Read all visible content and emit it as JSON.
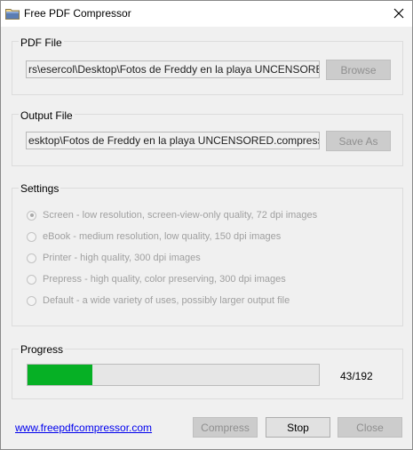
{
  "window": {
    "title": "Free PDF Compressor"
  },
  "pdf_file": {
    "label": "PDF File",
    "path": "rs\\esercol\\Desktop\\Fotos de Freddy en la playa UNCENSORED.pdf",
    "browse_label": "Browse"
  },
  "output_file": {
    "label": "Output File",
    "path": "esktop\\Fotos de Freddy en la playa UNCENSORED.compressed.pdf",
    "save_as_label": "Save As"
  },
  "settings": {
    "label": "Settings",
    "options": [
      {
        "label": "Screen - low resolution, screen-view-only quality, 72 dpi images",
        "selected": true
      },
      {
        "label": "eBook - medium resolution, low quality, 150 dpi images",
        "selected": false
      },
      {
        "label": "Printer - high quality, 300 dpi images",
        "selected": false
      },
      {
        "label": "Prepress - high quality, color preserving, 300 dpi images",
        "selected": false
      },
      {
        "label": "Default - a wide variety of uses, possibly larger output file",
        "selected": false
      }
    ]
  },
  "progress": {
    "label": "Progress",
    "current": 43,
    "total": 192,
    "count_text": "43/192",
    "bar_color": "#06b025"
  },
  "footer": {
    "link_text": "www.freepdfcompressor.com",
    "compress_label": "Compress",
    "stop_label": "Stop",
    "close_label": "Close"
  }
}
